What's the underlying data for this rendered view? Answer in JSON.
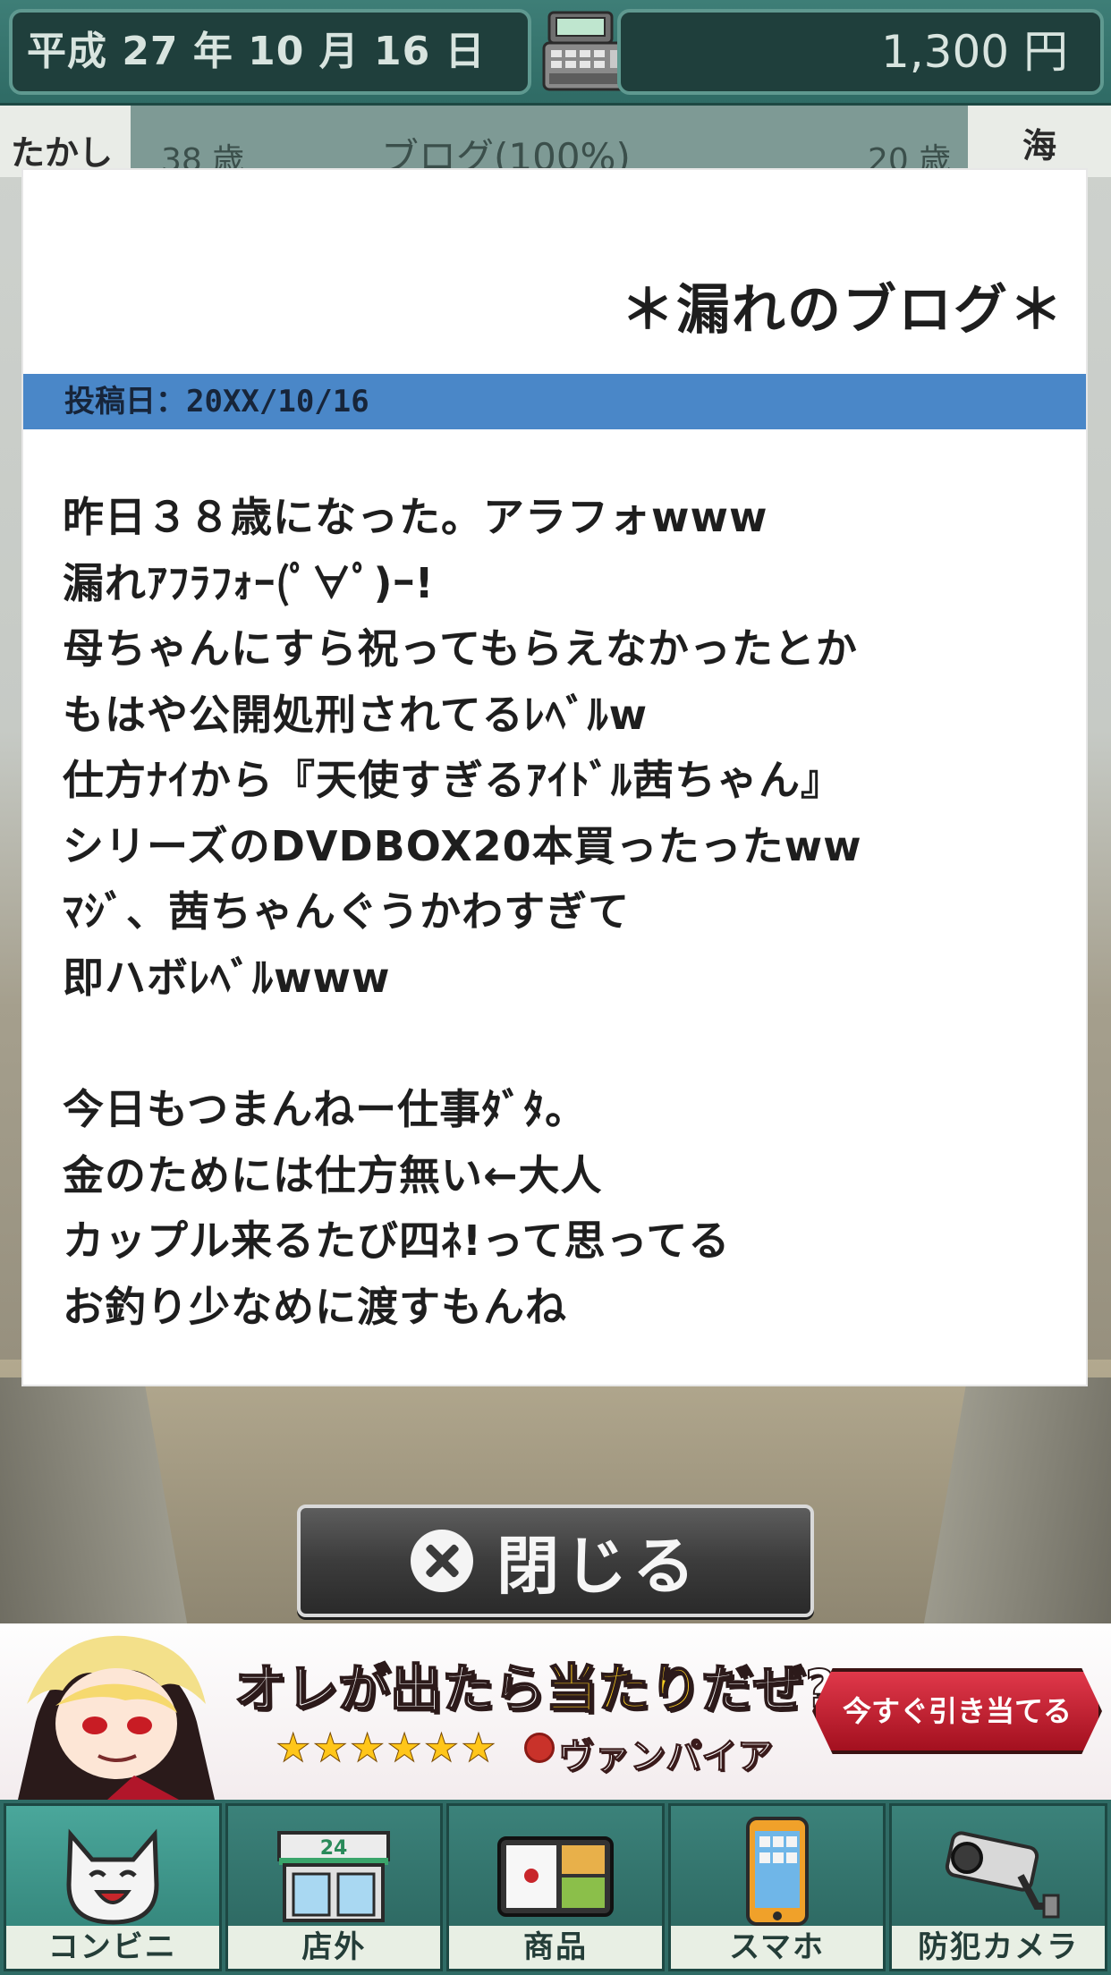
{
  "header": {
    "date": "平成 27 年 10 月 16 日",
    "money": "1,300 円"
  },
  "characters": {
    "left_name": "たかし",
    "left_age": "38 歳",
    "status": "ブログ(100%)",
    "right_age": "20 歳",
    "right_name": "海"
  },
  "modal": {
    "title": "＊漏れのブログ＊",
    "post_date": "投稿日：20XX/10/16",
    "paragraph1": [
      "昨日３８歳になった。アラフォwww",
      "漏れｱﾌﾗﾌｫｰ(ﾟ∀ﾟ)ｰ!",
      "母ちゃんにすら祝ってもらえなかったとか",
      "もはや公開処刑されてるﾚﾍﾞﾙw",
      "仕方ﾅｲから『天使すぎるｱｲﾄﾞﾙ茜ちゃん』",
      "シリーズのDVDBOX20本買ったったww",
      "ﾏｼﾞ、茜ちゃんぐうかわすぎて",
      "即ハボﾚﾍﾞﾙwww"
    ],
    "paragraph2": [
      "今日もつまんねー仕事ﾀﾞﾀ。",
      "金のためには仕方無い←大人",
      "カップル来るたび四ﾈ!って思ってる",
      "お釣り少なめに渡すもんね"
    ],
    "close_label": "閉じる"
  },
  "ad": {
    "headline_pre": "オレが出たら",
    "headline_hl": "当たり",
    "headline_post": "だぜ?",
    "stars": "★★★★★★",
    "subtitle": "ヴァンパイア",
    "cta": "今すぐ引き当てる"
  },
  "nav": [
    {
      "label": "コンビニ",
      "icon": "cat-icon"
    },
    {
      "label": "店外",
      "icon": "store-icon"
    },
    {
      "label": "商品",
      "icon": "bento-icon"
    },
    {
      "label": "スマホ",
      "icon": "smartphone-icon"
    },
    {
      "label": "防犯カメラ",
      "icon": "security-camera-icon"
    }
  ],
  "colors": {
    "topbar": "#2f6b65",
    "post_bar": "#4a87c8",
    "close_button": "#3c3c3c",
    "ad_cta": "#c41e2f"
  }
}
